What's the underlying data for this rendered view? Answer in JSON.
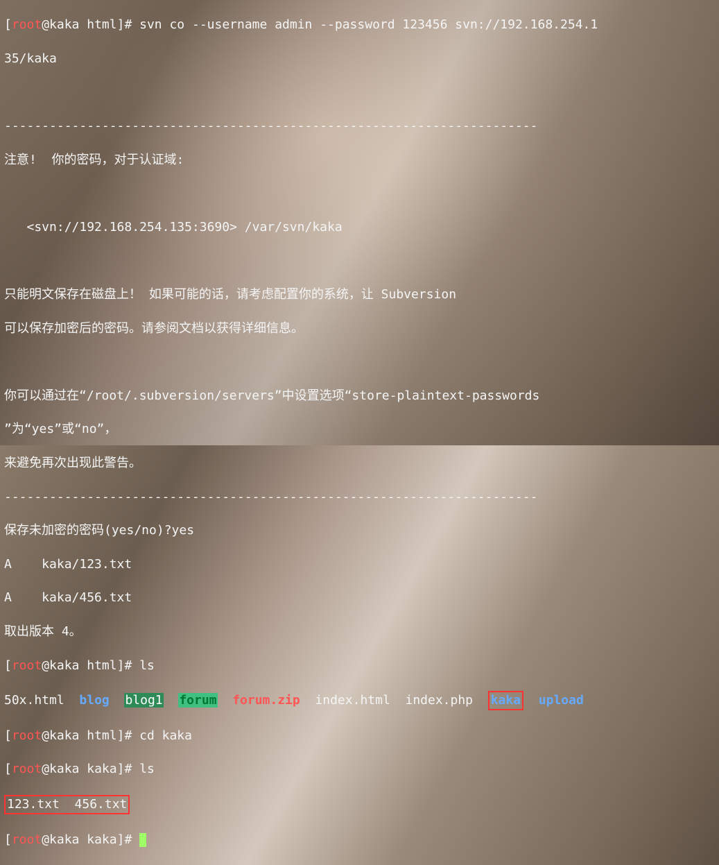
{
  "prompt": {
    "user": "root",
    "host": "kaka",
    "path_html": "html",
    "path_kaka": "kaka",
    "symbol": "#"
  },
  "lines": {
    "l1a": "[",
    "l1b": "@",
    "l1c": " ",
    "l1d": "]# ",
    "cmd1": "svn co --username admin --password 123456 svn://192.168.254.1",
    "cmd1b": "35/kaka",
    "sep1": "-----------------------------------------------------------------------",
    "warn1": "注意!  你的密码，对于认证域:",
    "warn2": "   <svn://192.168.254.135:3690> /var/svn/kaka",
    "warn3": "只能明文保存在磁盘上！ 如果可能的话，请考虑配置你的系统，让 Subversion",
    "warn4": "可以保存加密后的密码。请参阅文档以获得详细信息。",
    "warn5": "你可以通过在“/root/.subversion/servers”中设置选项“store-plaintext-passwords",
    "warn6": "”为“yes”或“no”，",
    "warn7": "来避免再次出现此警告。",
    "sep2": "-----------------------------------------------------------------------",
    "q1": "保存未加密的密码(yes/no)?yes",
    "a1": "A    kaka/123.txt",
    "a2": "A    kaka/456.txt",
    "rev": "取出版本 4。",
    "cmd_ls": "ls",
    "cmd_cd": "cd kaka",
    "ls1_50x": "50x.html",
    "ls1_blog": "blog",
    "ls1_blog1": "blog1",
    "ls1_forum": "forum",
    "ls1_forumzip": "forum.zip",
    "ls1_index_html": "index.html",
    "ls1_index_php": "index.php",
    "ls1_kaka": "kaka",
    "ls1_upload": "upload",
    "ls2": "123.txt  456.txt"
  }
}
